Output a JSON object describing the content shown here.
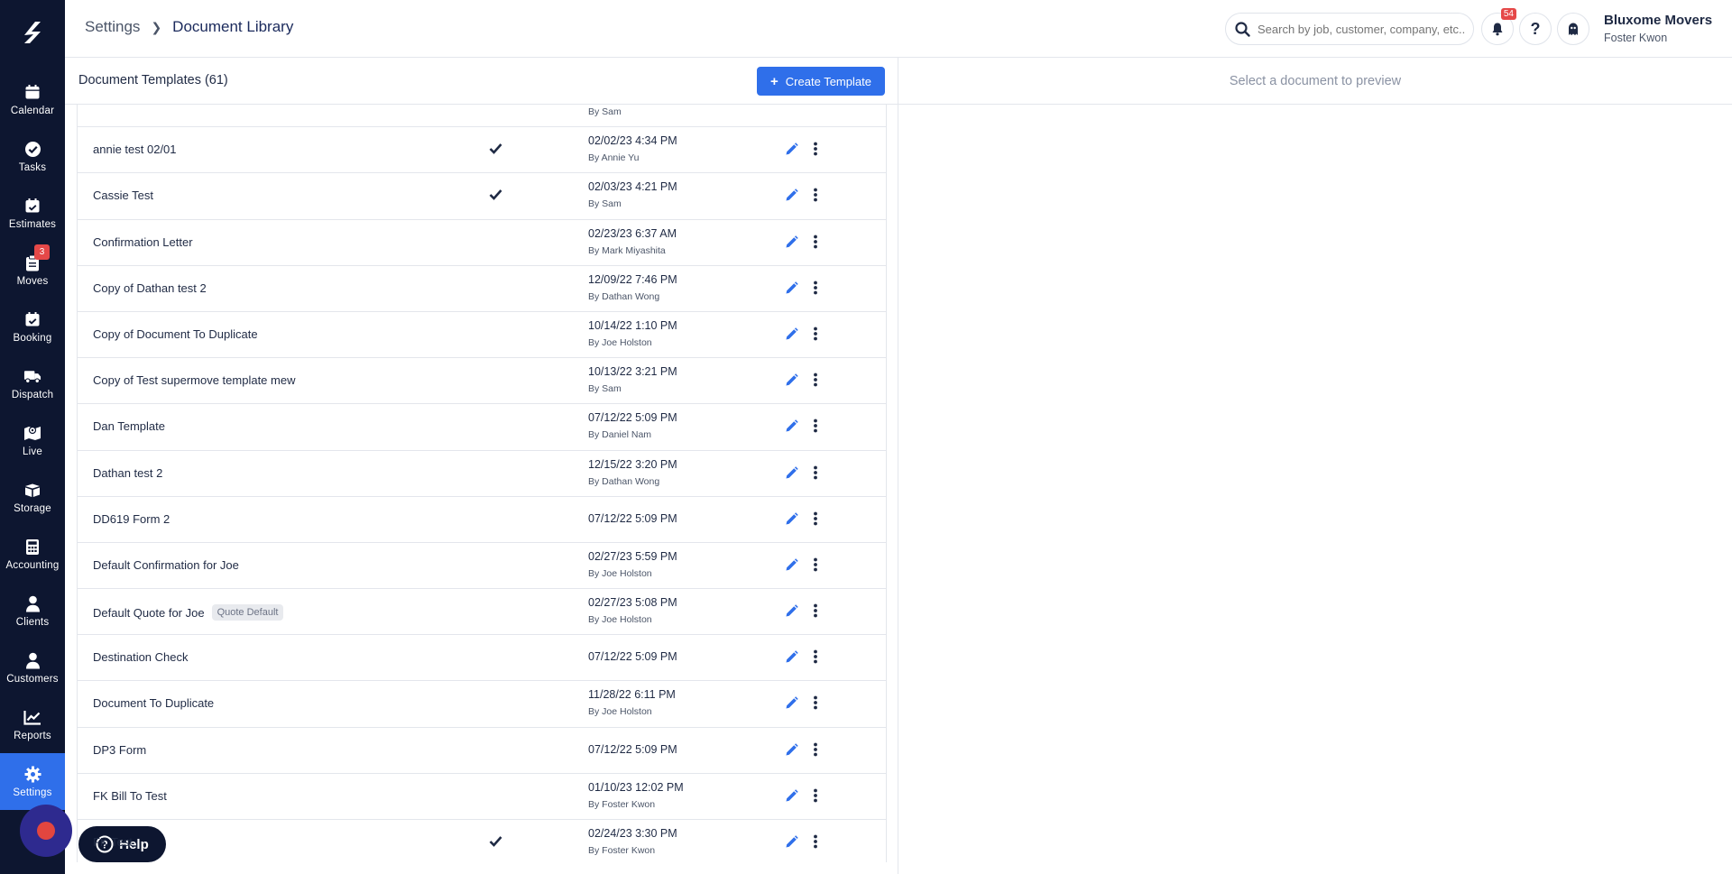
{
  "sidebar": {
    "items": [
      {
        "label": "Calendar",
        "icon": "calendar-icon"
      },
      {
        "label": "Tasks",
        "icon": "check-circle-icon"
      },
      {
        "label": "Estimates",
        "icon": "calendar-check-icon"
      },
      {
        "label": "Moves",
        "icon": "clipboard-icon",
        "badge": "3"
      },
      {
        "label": "Booking",
        "icon": "calendar-check-icon"
      },
      {
        "label": "Dispatch",
        "icon": "truck-icon"
      },
      {
        "label": "Live",
        "icon": "map-icon"
      },
      {
        "label": "Storage",
        "icon": "box-icon"
      },
      {
        "label": "Accounting",
        "icon": "calculator-icon"
      },
      {
        "label": "Clients",
        "icon": "user-icon"
      },
      {
        "label": "Customers",
        "icon": "user-icon"
      },
      {
        "label": "Reports",
        "icon": "chart-line-icon"
      },
      {
        "label": "Settings",
        "icon": "gear-icon",
        "active": true
      }
    ]
  },
  "help_label": "Help",
  "header": {
    "breadcrumb_root": "Settings",
    "breadcrumb_current": "Document Library",
    "search_placeholder": "Search by job, customer, company, etc...",
    "notification_count": "54",
    "company": "Bluxome Movers",
    "user": "Foster Kwon"
  },
  "templates": {
    "title": "Document Templates (61)",
    "create_label": "Create Template",
    "rows": [
      {
        "name": "",
        "checked": false,
        "date": "",
        "by": "By Sam",
        "tag": ""
      },
      {
        "name": "annie test 02/01",
        "checked": true,
        "date": "02/02/23 4:34 PM",
        "by": "By Annie Yu",
        "tag": ""
      },
      {
        "name": "Cassie Test",
        "checked": true,
        "date": "02/03/23 4:21 PM",
        "by": "By Sam",
        "tag": ""
      },
      {
        "name": "Confirmation Letter",
        "checked": false,
        "date": "02/23/23 6:37 AM",
        "by": "By Mark Miyashita",
        "tag": ""
      },
      {
        "name": "Copy of Dathan test 2",
        "checked": false,
        "date": "12/09/22 7:46 PM",
        "by": "By Dathan Wong",
        "tag": ""
      },
      {
        "name": "Copy of Document To Duplicate",
        "checked": false,
        "date": "10/14/22 1:10 PM",
        "by": "By Joe Holston",
        "tag": ""
      },
      {
        "name": "Copy of Test supermove template mew",
        "checked": false,
        "date": "10/13/22 3:21 PM",
        "by": "By Sam",
        "tag": ""
      },
      {
        "name": "Dan Template",
        "checked": false,
        "date": "07/12/22 5:09 PM",
        "by": "By Daniel Nam",
        "tag": ""
      },
      {
        "name": "Dathan test 2",
        "checked": false,
        "date": "12/15/22 3:20 PM",
        "by": "By Dathan Wong",
        "tag": ""
      },
      {
        "name": "DD619 Form 2",
        "checked": false,
        "date": "07/12/22 5:09 PM",
        "by": "",
        "tag": ""
      },
      {
        "name": "Default Confirmation for Joe",
        "checked": false,
        "date": "02/27/23 5:59 PM",
        "by": "By Joe Holston",
        "tag": ""
      },
      {
        "name": "Default Quote for Joe",
        "checked": false,
        "date": "02/27/23 5:08 PM",
        "by": "By Joe Holston",
        "tag": "Quote Default"
      },
      {
        "name": "Destination Check",
        "checked": false,
        "date": "07/12/22 5:09 PM",
        "by": "",
        "tag": ""
      },
      {
        "name": "Document To Duplicate",
        "checked": false,
        "date": "11/28/22 6:11 PM",
        "by": "By Joe Holston",
        "tag": ""
      },
      {
        "name": "DP3 Form",
        "checked": false,
        "date": "07/12/22 5:09 PM",
        "by": "",
        "tag": ""
      },
      {
        "name": "FK Bill To Test",
        "checked": false,
        "date": "01/10/23 12:02 PM",
        "by": "By Foster Kwon",
        "tag": ""
      },
      {
        "name": "FK Test",
        "checked": true,
        "date": "02/24/23 3:30 PM",
        "by": "By Foster Kwon",
        "tag": ""
      }
    ]
  },
  "preview": {
    "placeholder": "Select a document to preview"
  },
  "colors": {
    "sidebar": "#0d1630",
    "accent": "#2f6fea",
    "badge": "#e54848"
  }
}
